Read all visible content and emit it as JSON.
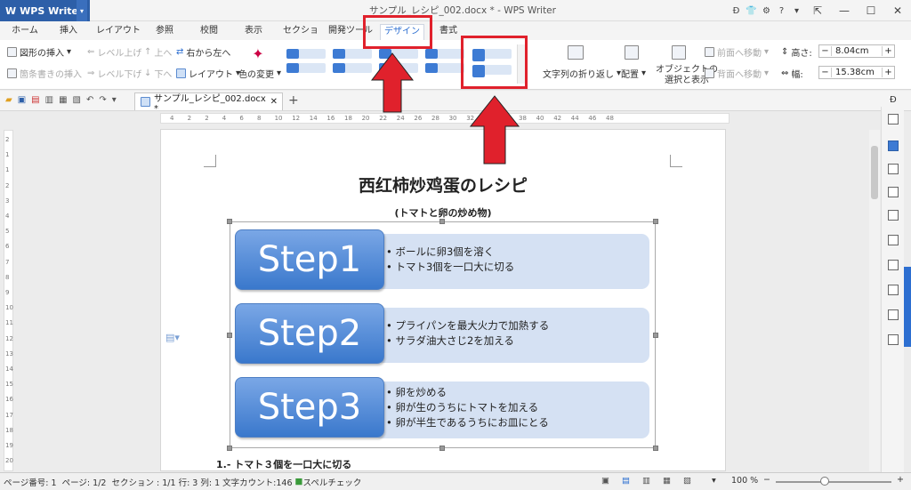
{
  "app": {
    "name": "WPS Writer",
    "window_title": "サンプル_レシピ_002.docx * - WPS Writer"
  },
  "tabs": [
    "ホーム",
    "挿入",
    "レイアウト",
    "参照",
    "校閲",
    "表示",
    "セクション",
    "開発ツール",
    "デザイン",
    "書式"
  ],
  "active_tab": "デザイン",
  "ribbon": {
    "insert_shape": "図形の挿入",
    "insert_bullet": "箇条書きの挿入",
    "level_up": "レベル上げ",
    "level_down": "レベル下げ",
    "move_up": "上へ",
    "move_down": "下へ",
    "right_to_left": "右から左へ",
    "layout": "レイアウト",
    "change_color": "色の変更",
    "wrap_text": "文字列の折り返し",
    "arrange": "配置",
    "select_show_line1": "オブジェクトの",
    "select_show_line2": "選択と表示",
    "bring_forward": "前面へ移動",
    "send_backward": "背面へ移動",
    "height_label": "高さ:",
    "height_value": "8.04cm",
    "width_label": "幅:",
    "width_value": "15.38cm"
  },
  "doc_tab": "サンプル_レシピ_002.docx *",
  "document": {
    "title": "西红柿炒鸡蛋のレシピ",
    "subtitle": "(トマトと卵の炒め物)",
    "steps": [
      {
        "label": "Step1",
        "bullets": [
          "ボールに卵3個を溶く",
          "トマト3個を一口大に切る"
        ]
      },
      {
        "label": "Step2",
        "bullets": [
          "プライパンを最大火力で加熱する",
          "サラダ油大さじ2を加える"
        ]
      },
      {
        "label": "Step3",
        "bullets": [
          "卵を炒める",
          "卵が生のうちにトマトを加える",
          "卵が半生であるうちにお皿にとる"
        ]
      }
    ],
    "list_item": "1.- トマト３個を一口大に切る"
  },
  "ruler_numbers": [
    "4",
    "2",
    "2",
    "4",
    "6",
    "8",
    "10",
    "12",
    "14",
    "16",
    "18",
    "20",
    "22",
    "24",
    "26",
    "28",
    "30",
    "32",
    "34",
    "36",
    "38",
    "40",
    "42",
    "44",
    "46",
    "48"
  ],
  "vruler_numbers": [
    "2",
    "1",
    "1",
    "2",
    "3",
    "4",
    "5",
    "6",
    "7",
    "8",
    "9",
    "10",
    "11",
    "12",
    "13",
    "14",
    "15",
    "16",
    "17",
    "18",
    "19",
    "20"
  ],
  "status": {
    "page_number": "ページ番号: 1",
    "pages": "ページ: 1/2",
    "section": "セクション : 1/1",
    "row": "行: 3",
    "column": "列: 1",
    "char_count": "文字カウント:146",
    "spell_check": "スペルチェック",
    "zoom": "100 %"
  },
  "colors": {
    "accent": "#2d6fd1",
    "annotation_red": "#e0212c",
    "step_blue": "#3a78cc",
    "step_body": "#d5e1f3"
  }
}
